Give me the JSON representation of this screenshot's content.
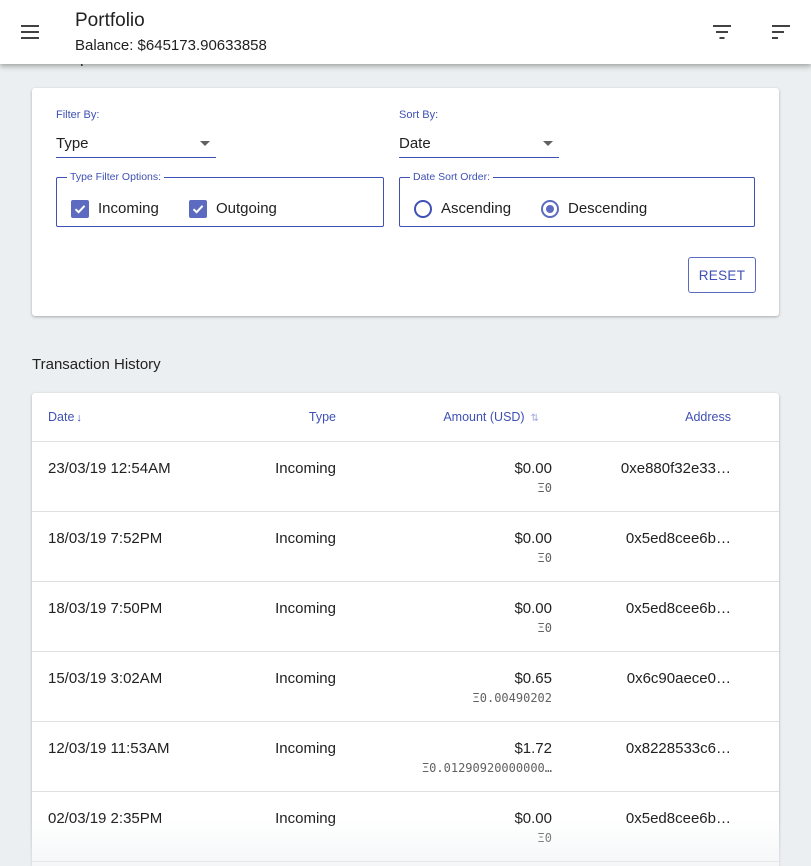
{
  "appbar": {
    "title": "Portfolio",
    "balance": "Balance: $645173.90633858",
    "menu_icon": "menu-icon",
    "filter_icon": "filter-list-icon",
    "sort_icon": "sort-icon"
  },
  "view_options": {
    "heading": "View Options",
    "filter_by_label": "Filter By:",
    "filter_by_value": "Type",
    "sort_by_label": "Sort By:",
    "sort_by_value": "Date",
    "type_filter_legend": "Type Filter Options:",
    "incoming_label": "Incoming",
    "incoming_checked": true,
    "outgoing_label": "Outgoing",
    "outgoing_checked": true,
    "date_sort_legend": "Date Sort Order:",
    "ascending_label": "Ascending",
    "descending_label": "Descending",
    "selected_order": "Descending",
    "reset_label": "RESET"
  },
  "transactions": {
    "heading": "Transaction History",
    "columns": {
      "date": "Date",
      "date_sort": "↓",
      "type": "Type",
      "amount": "Amount (USD)",
      "amount_sort": "⇅",
      "address": "Address"
    },
    "rows": [
      {
        "date": "23/03/19 12:54AM",
        "type": "Incoming",
        "usd": "$0.00",
        "eth": "Ξ0",
        "address": "0xe880f32e33…"
      },
      {
        "date": "18/03/19 7:52PM",
        "type": "Incoming",
        "usd": "$0.00",
        "eth": "Ξ0",
        "address": "0x5ed8cee6b…"
      },
      {
        "date": "18/03/19 7:50PM",
        "type": "Incoming",
        "usd": "$0.00",
        "eth": "Ξ0",
        "address": "0x5ed8cee6b…"
      },
      {
        "date": "15/03/19 3:02AM",
        "type": "Incoming",
        "usd": "$0.65",
        "eth": "Ξ0.00490202",
        "address": "0x6c90aece0…"
      },
      {
        "date": "12/03/19 11:53AM",
        "type": "Incoming",
        "usd": "$1.72",
        "eth": "Ξ0.01290920000000…",
        "address": "0x8228533c6…"
      },
      {
        "date": "02/03/19 2:35PM",
        "type": "Incoming",
        "usd": "$0.00",
        "eth": "Ξ0",
        "address": "0x5ed8cee6b…"
      }
    ]
  },
  "colors": {
    "accent": "#3f51b5",
    "checkbox": "#5c6bc0",
    "background": "#eceff1"
  }
}
